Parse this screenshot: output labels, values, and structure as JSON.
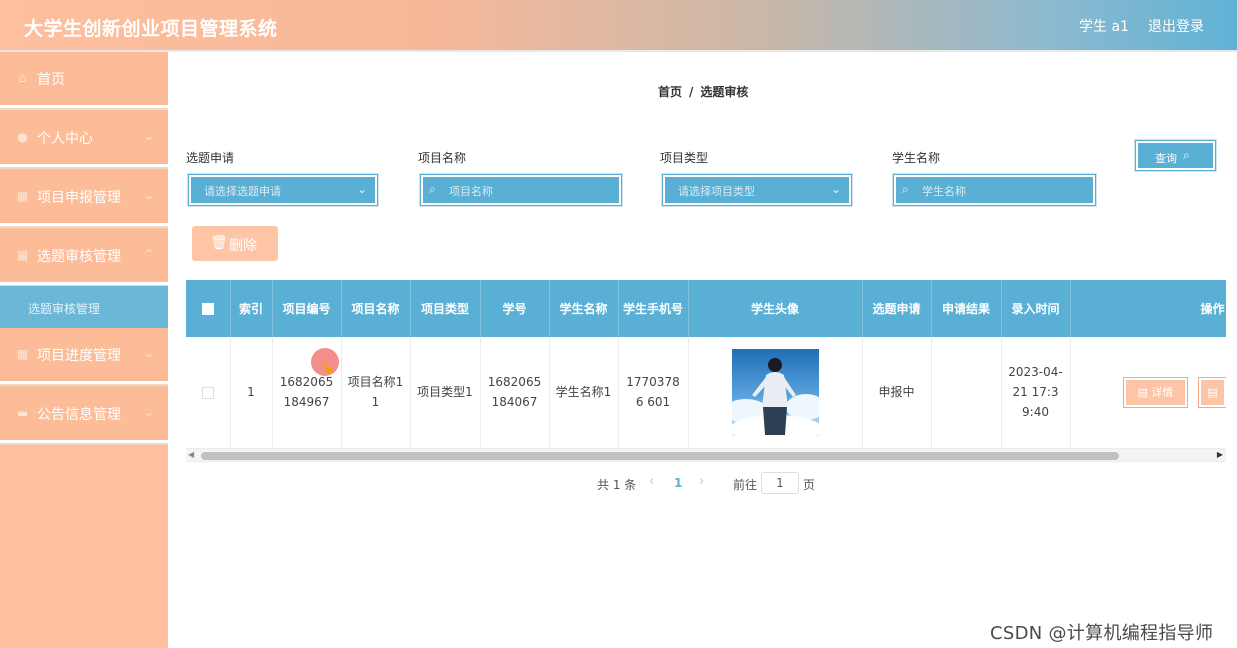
{
  "header": {
    "app_title": "大学生创新创业项目管理系统",
    "user_name": "学生 a1",
    "logout": "退出登录"
  },
  "sidebar": {
    "items": [
      {
        "label": "首页",
        "icon": "home-icon",
        "has_arrow": false
      },
      {
        "label": "个人中心",
        "icon": "user-icon",
        "has_arrow": true
      },
      {
        "label": "项目申报管理",
        "icon": "grid-icon",
        "has_arrow": true
      },
      {
        "label": "选题审核管理",
        "icon": "grid-icon",
        "has_arrow": true
      },
      {
        "label": "项目进度管理",
        "icon": "grid-icon",
        "has_arrow": true
      },
      {
        "label": "公告信息管理",
        "icon": "message-icon",
        "has_arrow": true
      }
    ],
    "active_submenu": "选题审核管理"
  },
  "breadcrumb": {
    "home": "首页",
    "separator": "/",
    "current": "选题审核"
  },
  "search": {
    "fields": [
      {
        "label": "选题申请",
        "type": "select",
        "placeholder": "请选择选题申请"
      },
      {
        "label": "项目名称",
        "type": "text",
        "placeholder": "项目名称"
      },
      {
        "label": "项目类型",
        "type": "select",
        "placeholder": "请选择项目类型"
      },
      {
        "label": "学生名称",
        "type": "text",
        "placeholder": "学生名称"
      }
    ],
    "query_button": "查询"
  },
  "actions": {
    "delete_button": "删除"
  },
  "table": {
    "columns": [
      "",
      "索引",
      "项目编号",
      "项目名称",
      "项目类型",
      "学号",
      "学生名称",
      "学生手机号",
      "学生头像",
      "选题申请",
      "申请结果",
      "录入时间",
      "操作"
    ],
    "rows": [
      {
        "index": "1",
        "project_no": "1682065 184967",
        "project_name": "项目名称11",
        "project_type": "项目类型1",
        "student_no": "1682065 184067",
        "student_name": "学生名称1",
        "phone": "17703786 601",
        "topic_apply": "申报中",
        "apply_result": "",
        "entry_time": "2023-04-21 17:39:40",
        "detail_button": "详情"
      }
    ]
  },
  "pagination": {
    "total": "共 1 条",
    "current_page": "1",
    "goto_label": "前往",
    "goto_value": "1",
    "page_unit": "页"
  },
  "watermark": "CSDN @计算机编程指导师",
  "colors": {
    "accent_blue": "#5aafd5",
    "sidebar_peach": "#fdbf9d",
    "button_peach": "#fdc5a6"
  }
}
